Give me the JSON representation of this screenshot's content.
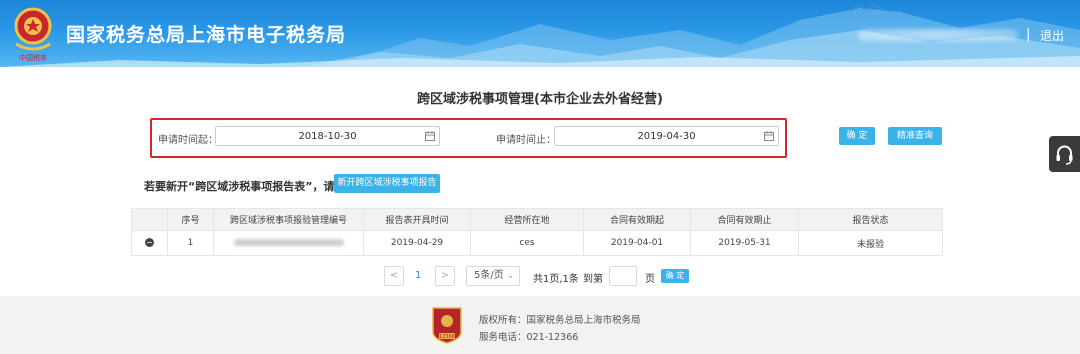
{
  "header": {
    "title": "国家税务总局上海市电子税务局",
    "separator": "|",
    "logout": "退出",
    "emblem_caption": "中国税务"
  },
  "page_title": "跨区域涉税事项管理(本市企业去外省经营)",
  "filter": {
    "start_label": "申请时间起：",
    "start_value": "2018-10-30",
    "end_label": "申请时间止：",
    "end_value": "2019-04-30",
    "confirm_label": "确 定",
    "precise_query_label": "精准查询"
  },
  "prompt": {
    "text": "若要新开“跨区域涉税事项报告表”，请点击：",
    "button_label": "新开跨区域涉税事项报告"
  },
  "table": {
    "headers": [
      "序号",
      "跨区域涉税事项报验管理编号",
      "报告表开具时间",
      "经营所在地",
      "合同有效期起",
      "合同有效期止",
      "报告状态"
    ],
    "rows": [
      {
        "index": "1",
        "code": "",
        "open_date": "2019-04-29",
        "location": "ces",
        "contract_start": "2019-04-01",
        "contract_end": "2019-05-31",
        "status": "未报验"
      }
    ]
  },
  "pagination": {
    "prev": "<",
    "current_page": "1",
    "next": ">",
    "page_size": "5条/页",
    "summary": "共1页,1条",
    "goto_label": "到第",
    "goto_value": "",
    "page_unit": "页",
    "confirm_label": "确 定"
  },
  "footer": {
    "copyright": "版权所有：国家税务总局上海市税务局",
    "phone": "服务电话：021-12366",
    "logo_caption": "12366"
  },
  "colors": {
    "header_blue": "#1e86d8",
    "button_blue": "#3ab3ea",
    "highlight_red": "#d9252b",
    "footer_gray": "#f2f2f2"
  }
}
